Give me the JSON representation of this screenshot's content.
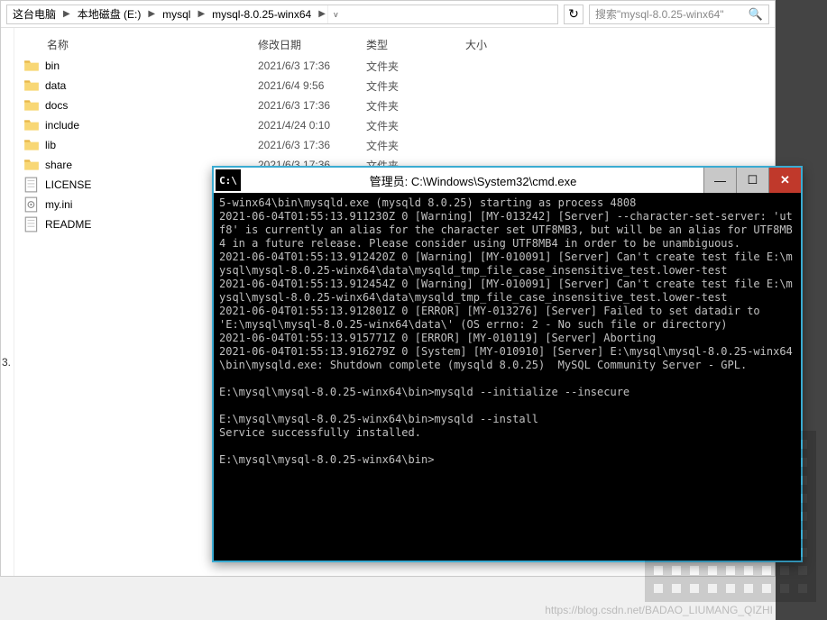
{
  "breadcrumbs": [
    "这台电脑",
    "本地磁盘 (E:)",
    "mysql",
    "mysql-8.0.25-winx64"
  ],
  "search_placeholder": "搜索\"mysql-8.0.25-winx64\"",
  "columns": {
    "name": "名称",
    "date": "修改日期",
    "type": "类型",
    "size": "大小"
  },
  "files": [
    {
      "name": "bin",
      "date": "2021/6/3 17:36",
      "type": "文件夹",
      "kind": "folder"
    },
    {
      "name": "data",
      "date": "2021/6/4 9:56",
      "type": "文件夹",
      "kind": "folder"
    },
    {
      "name": "docs",
      "date": "2021/6/3 17:36",
      "type": "文件夹",
      "kind": "folder"
    },
    {
      "name": "include",
      "date": "2021/4/24 0:10",
      "type": "文件夹",
      "kind": "folder"
    },
    {
      "name": "lib",
      "date": "2021/6/3 17:36",
      "type": "文件夹",
      "kind": "folder"
    },
    {
      "name": "share",
      "date": "2021/6/3 17:36",
      "type": "文件夹",
      "kind": "folder"
    },
    {
      "name": "LICENSE",
      "date": "",
      "type": "",
      "kind": "file"
    },
    {
      "name": "my.ini",
      "date": "",
      "type": "",
      "kind": "ini"
    },
    {
      "name": "README",
      "date": "",
      "type": "",
      "kind": "file"
    }
  ],
  "sidebar_marker": "3.",
  "console": {
    "title": "管理员: C:\\Windows\\System32\\cmd.exe",
    "lines": [
      "5-winx64\\bin\\mysqld.exe (mysqld 8.0.25) starting as process 4808",
      "2021-06-04T01:55:13.911230Z 0 [Warning] [MY-013242] [Server] --character-set-server: 'utf8' is currently an alias for the character set UTF8MB3, but will be an alias for UTF8MB4 in a future release. Please consider using UTF8MB4 in order to be unambiguous.",
      "2021-06-04T01:55:13.912420Z 0 [Warning] [MY-010091] [Server] Can't create test file E:\\mysql\\mysql-8.0.25-winx64\\data\\mysqld_tmp_file_case_insensitive_test.lower-test",
      "2021-06-04T01:55:13.912454Z 0 [Warning] [MY-010091] [Server] Can't create test file E:\\mysql\\mysql-8.0.25-winx64\\data\\mysqld_tmp_file_case_insensitive_test.lower-test",
      "2021-06-04T01:55:13.912801Z 0 [ERROR] [MY-013276] [Server] Failed to set datadir to 'E:\\mysql\\mysql-8.0.25-winx64\\data\\' (OS errno: 2 - No such file or directory)",
      "2021-06-04T01:55:13.915771Z 0 [ERROR] [MY-010119] [Server] Aborting",
      "2021-06-04T01:55:13.916279Z 0 [System] [MY-010910] [Server] E:\\mysql\\mysql-8.0.25-winx64\\bin\\mysqld.exe: Shutdown complete (mysqld 8.0.25)  MySQL Community Server - GPL.",
      "",
      "E:\\mysql\\mysql-8.0.25-winx64\\bin>mysqld --initialize --insecure",
      "",
      "E:\\mysql\\mysql-8.0.25-winx64\\bin>mysqld --install",
      "Service successfully installed.",
      "",
      "E:\\mysql\\mysql-8.0.25-winx64\\bin>"
    ]
  },
  "watermark": "https://blog.csdn.net/BADAO_LIUMANG_QIZHI"
}
